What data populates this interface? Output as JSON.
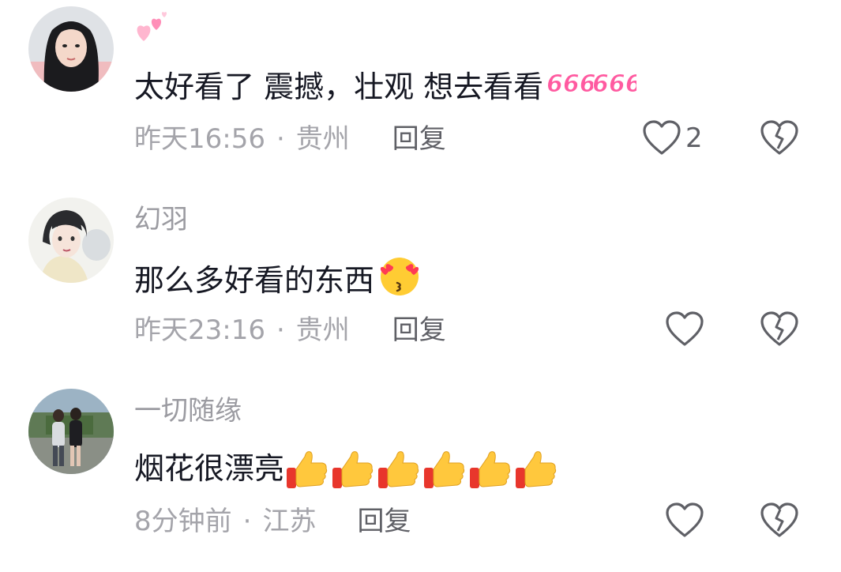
{
  "comments": [
    {
      "username": "",
      "text": "太好看了 震撼，壮观 想去看看",
      "inline_emoji": "666-sticker",
      "time": "昨天16:56",
      "location": "贵州",
      "reply_label": "回复",
      "like_count": "2",
      "avatar_icon": "girl-portrait-avatar",
      "name_emoji": "hearts-icon"
    },
    {
      "username": "幻羽",
      "text": "那么多好看的东西",
      "inline_emoji": "heart-eyes-kiss-emoji",
      "time": "昨天23:16",
      "location": "贵州",
      "reply_label": "回复",
      "like_count": "",
      "avatar_icon": "anime-boy-avatar"
    },
    {
      "username": "一切随缘",
      "text": "烟花很漂亮",
      "inline_emoji": "thumbs-up-emoji",
      "inline_emoji_count": 6,
      "time": "8分钟前",
      "location": "江苏",
      "reply_label": "回复",
      "like_count": "",
      "avatar_icon": "couple-photo-avatar"
    }
  ],
  "colors": {
    "text": "#161823",
    "secondary": "#a4a4aa",
    "username": "#9b9ba1",
    "icon": "#5f6066",
    "accent_pink": "#ff5aa0",
    "thumb_yellow": "#ffc83d",
    "thumb_red": "#e8362c"
  }
}
